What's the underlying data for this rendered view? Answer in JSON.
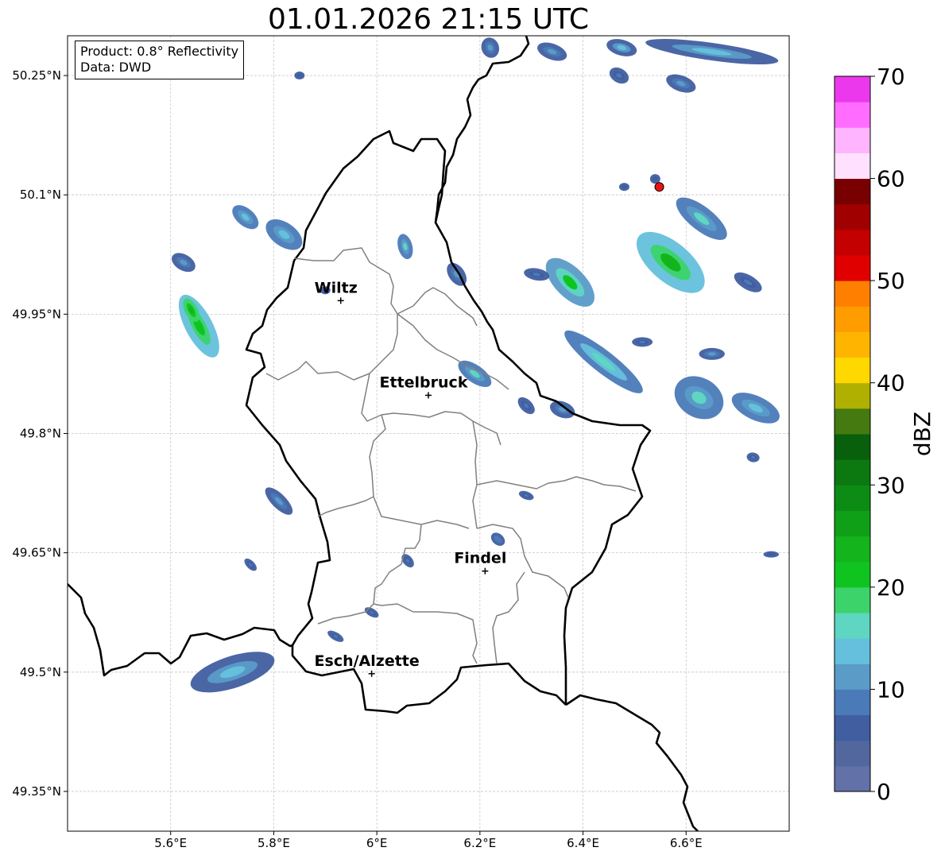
{
  "title": "01.01.2026 21:15 UTC",
  "info_box": {
    "product_text": "Product: 0.8° Reflectivity",
    "data_text": "Data: DWD"
  },
  "map": {
    "lon_range": [
      5.4,
      6.8
    ],
    "lat_range": [
      49.3,
      50.3
    ],
    "lon_ticks": [
      {
        "value": 5.6,
        "label": "5.6°E"
      },
      {
        "value": 5.8,
        "label": "5.8°E"
      },
      {
        "value": 6.0,
        "label": "6°E"
      },
      {
        "value": 6.2,
        "label": "6.2°E"
      },
      {
        "value": 6.4,
        "label": "6.4°E"
      },
      {
        "value": 6.6,
        "label": "6.6°E"
      }
    ],
    "lat_ticks": [
      {
        "value": 49.35,
        "label": "49.35°N"
      },
      {
        "value": 49.5,
        "label": "49.5°N"
      },
      {
        "value": 49.65,
        "label": "49.65°N"
      },
      {
        "value": 49.8,
        "label": "49.8°N"
      },
      {
        "value": 49.95,
        "label": "49.95°N"
      },
      {
        "value": 50.1,
        "label": "50.1°N"
      },
      {
        "value": 50.25,
        "label": "50.25°N"
      }
    ],
    "grid": true,
    "cities": [
      {
        "name": "Wiltz",
        "lon": 5.93,
        "lat": 49.967
      },
      {
        "name": "Ettelbruck",
        "lon": 6.1,
        "lat": 49.848
      },
      {
        "name": "Findel",
        "lon": 6.21,
        "lat": 49.627
      },
      {
        "name": "Esch/Alzette",
        "lon": 5.99,
        "lat": 49.498
      }
    ],
    "radar_site": {
      "lon": 6.548,
      "lat": 50.11,
      "color": "#ee1111"
    },
    "echoes": [
      {
        "lon": 5.655,
        "lat": 49.935,
        "len": 0.135,
        "wid": 0.034,
        "angle": 62,
        "dbz": 13,
        "core": 22
      },
      {
        "lon": 5.64,
        "lat": 49.955,
        "len": 0.05,
        "wid": 0.016,
        "angle": 62,
        "dbz": 18,
        "core": 24
      },
      {
        "lon": 5.745,
        "lat": 50.072,
        "len": 0.06,
        "wid": 0.022,
        "angle": 40,
        "dbz": 8,
        "core": 14
      },
      {
        "lon": 5.82,
        "lat": 50.05,
        "len": 0.08,
        "wid": 0.03,
        "angle": 35,
        "dbz": 8,
        "core": 14
      },
      {
        "lon": 5.625,
        "lat": 50.015,
        "len": 0.05,
        "wid": 0.02,
        "angle": 30,
        "dbz": 6,
        "core": 11
      },
      {
        "lon": 6.055,
        "lat": 50.035,
        "len": 0.05,
        "wid": 0.018,
        "angle": 75,
        "dbz": 8,
        "core": 16
      },
      {
        "lon": 6.155,
        "lat": 50.0,
        "len": 0.05,
        "wid": 0.02,
        "angle": 55,
        "dbz": 6,
        "core": 12
      },
      {
        "lon": 6.19,
        "lat": 49.875,
        "len": 0.075,
        "wid": 0.022,
        "angle": 35,
        "dbz": 9,
        "core": 15
      },
      {
        "lon": 6.375,
        "lat": 49.99,
        "len": 0.12,
        "wid": 0.038,
        "angle": 45,
        "dbz": 11,
        "core": 22
      },
      {
        "lon": 6.44,
        "lat": 49.89,
        "len": 0.19,
        "wid": 0.028,
        "angle": 38,
        "dbz": 9,
        "core": 16
      },
      {
        "lon": 6.57,
        "lat": 50.015,
        "len": 0.16,
        "wid": 0.05,
        "angle": 40,
        "dbz": 14,
        "core": 24
      },
      {
        "lon": 6.63,
        "lat": 50.07,
        "len": 0.12,
        "wid": 0.03,
        "angle": 38,
        "dbz": 8,
        "core": 16
      },
      {
        "lon": 6.72,
        "lat": 49.99,
        "len": 0.06,
        "wid": 0.018,
        "angle": 30,
        "dbz": 5,
        "core": 9
      },
      {
        "lon": 6.625,
        "lat": 49.845,
        "len": 0.1,
        "wid": 0.05,
        "angle": 30,
        "dbz": 9,
        "core": 15
      },
      {
        "lon": 6.735,
        "lat": 49.832,
        "len": 0.1,
        "wid": 0.03,
        "angle": 25,
        "dbz": 8,
        "core": 13
      },
      {
        "lon": 6.65,
        "lat": 49.9,
        "len": 0.05,
        "wid": 0.015,
        "angle": 0,
        "dbz": 6,
        "core": 10
      },
      {
        "lon": 6.36,
        "lat": 49.83,
        "len": 0.05,
        "wid": 0.02,
        "angle": 20,
        "dbz": 6,
        "core": 12
      },
      {
        "lon": 6.29,
        "lat": 49.835,
        "len": 0.04,
        "wid": 0.015,
        "angle": 45,
        "dbz": 5,
        "core": 9
      },
      {
        "lon": 6.31,
        "lat": 50.0,
        "len": 0.05,
        "wid": 0.015,
        "angle": 10,
        "dbz": 5,
        "core": 9
      },
      {
        "lon": 6.22,
        "lat": 50.285,
        "len": 0.04,
        "wid": 0.022,
        "angle": 70,
        "dbz": 6,
        "core": 12
      },
      {
        "lon": 6.34,
        "lat": 50.28,
        "len": 0.06,
        "wid": 0.02,
        "angle": 20,
        "dbz": 6,
        "core": 12
      },
      {
        "lon": 6.475,
        "lat": 50.285,
        "len": 0.06,
        "wid": 0.02,
        "angle": 15,
        "dbz": 7,
        "core": 14
      },
      {
        "lon": 6.65,
        "lat": 50.28,
        "len": 0.26,
        "wid": 0.022,
        "angle": 8,
        "dbz": 7,
        "core": 14
      },
      {
        "lon": 6.59,
        "lat": 50.24,
        "len": 0.06,
        "wid": 0.02,
        "angle": 20,
        "dbz": 6,
        "core": 11
      },
      {
        "lon": 6.47,
        "lat": 50.25,
        "len": 0.04,
        "wid": 0.018,
        "angle": 30,
        "dbz": 5,
        "core": 9
      },
      {
        "lon": 5.81,
        "lat": 49.715,
        "len": 0.07,
        "wid": 0.018,
        "angle": 45,
        "dbz": 7,
        "core": 12
      },
      {
        "lon": 5.72,
        "lat": 49.5,
        "len": 0.17,
        "wid": 0.04,
        "angle": -18,
        "dbz": 7,
        "core": 13
      },
      {
        "lon": 5.755,
        "lat": 49.635,
        "len": 0.03,
        "wid": 0.01,
        "angle": 45,
        "dbz": 5,
        "core": 8
      },
      {
        "lon": 5.92,
        "lat": 49.545,
        "len": 0.035,
        "wid": 0.01,
        "angle": 30,
        "dbz": 5,
        "core": 8
      },
      {
        "lon": 5.99,
        "lat": 49.575,
        "len": 0.03,
        "wid": 0.01,
        "angle": 30,
        "dbz": 5,
        "core": 8
      },
      {
        "lon": 6.06,
        "lat": 49.64,
        "len": 0.03,
        "wid": 0.012,
        "angle": 50,
        "dbz": 5,
        "core": 8
      },
      {
        "lon": 6.235,
        "lat": 49.667,
        "len": 0.03,
        "wid": 0.014,
        "angle": 40,
        "dbz": 6,
        "core": 9
      },
      {
        "lon": 6.29,
        "lat": 49.722,
        "len": 0.03,
        "wid": 0.01,
        "angle": 20,
        "dbz": 5,
        "core": 8
      },
      {
        "lon": 6.765,
        "lat": 49.648,
        "len": 0.03,
        "wid": 0.008,
        "angle": 0,
        "dbz": 5,
        "core": 7
      },
      {
        "lon": 6.54,
        "lat": 50.12,
        "len": 0.02,
        "wid": 0.012,
        "angle": 0,
        "dbz": 5,
        "core": 7
      },
      {
        "lon": 6.48,
        "lat": 50.11,
        "len": 0.02,
        "wid": 0.01,
        "angle": 0,
        "dbz": 5,
        "core": 7
      },
      {
        "lon": 5.9,
        "lat": 49.98,
        "len": 0.02,
        "wid": 0.01,
        "angle": 0,
        "dbz": 5,
        "core": 7
      },
      {
        "lon": 5.85,
        "lat": 50.25,
        "len": 0.02,
        "wid": 0.01,
        "angle": 0,
        "dbz": 5,
        "core": 7
      },
      {
        "lon": 6.73,
        "lat": 49.77,
        "len": 0.025,
        "wid": 0.012,
        "angle": 10,
        "dbz": 5,
        "core": 9
      },
      {
        "lon": 6.515,
        "lat": 49.915,
        "len": 0.04,
        "wid": 0.012,
        "angle": 0,
        "dbz": 5,
        "core": 9
      }
    ]
  },
  "colorbar": {
    "label": "dBZ",
    "min": 0,
    "max": 70,
    "step": 2.5,
    "tick_values": [
      0,
      10,
      20,
      30,
      40,
      50,
      60,
      70
    ],
    "tick_labels": [
      "0",
      "10",
      "20",
      "30",
      "40",
      "50",
      "60",
      "70"
    ],
    "colors": [
      "#6272a8",
      "#51679e",
      "#405ea0",
      "#4a7ab8",
      "#5a9bc8",
      "#64c0dc",
      "#5ed6c2",
      "#3cd46a",
      "#10c420",
      "#14b41c",
      "#10a018",
      "#0c8c14",
      "#0c7810",
      "#08600c",
      "#447a10",
      "#b0b000",
      "#ffd800",
      "#ffb400",
      "#ff9c00",
      "#ff8000",
      "#e00000",
      "#c40000",
      "#a00000",
      "#780000",
      "#ffe0ff",
      "#ffb4ff",
      "#ff6cff",
      "#ec38ec"
    ]
  }
}
